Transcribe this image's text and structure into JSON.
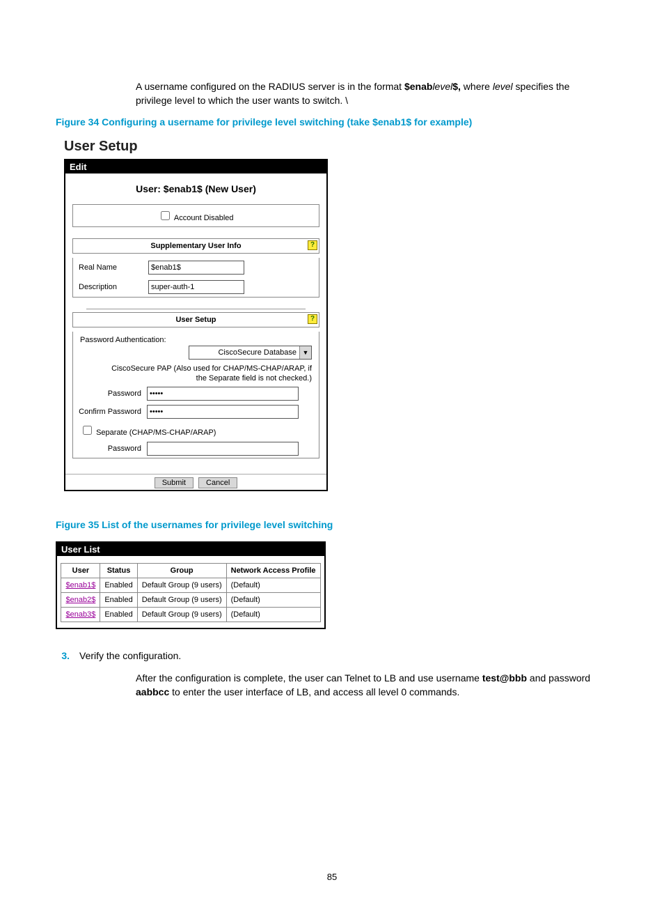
{
  "intro": {
    "line_pre": "A username configured on the RADIUS server is in the format ",
    "token1": "$enab",
    "token_it": "level",
    "token2": "$,",
    "line_mid1": " where ",
    "token_level": "level",
    "line_mid2": " specifies the privilege level to which the user wants to switch. \\"
  },
  "figure34_caption": "Figure 34 Configuring a username for privilege level switching (take $enab1$ for example)",
  "user_setup": {
    "panel_title": "User Setup",
    "edit_label": "Edit",
    "user_heading": "User: $enab1$ (New User)",
    "account_disabled_label": "Account Disabled",
    "supp_header": "Supplementary User Info",
    "real_name_label": "Real Name",
    "real_name_value": "$enab1$",
    "description_label": "Description",
    "description_value": "super-auth-1",
    "setup_header": "User Setup",
    "pw_auth_label": "Password Authentication:",
    "pw_auth_select": "CiscoSecure Database",
    "pap_note": "CiscoSecure PAP (Also used for CHAP/MS-CHAP/ARAP, if the Separate field is not checked.)",
    "password_label": "Password",
    "confirm_label": "Confirm Password",
    "password_mask": "•••••",
    "separate_label": "Separate (CHAP/MS-CHAP/ARAP)",
    "submit_label": "Submit",
    "cancel_label": "Cancel",
    "help_symbol": "?"
  },
  "figure35_caption": "Figure 35 List of the usernames for privilege level switching",
  "user_list": {
    "header": "User List",
    "columns": [
      "User",
      "Status",
      "Group",
      "Network Access Profile"
    ],
    "rows": [
      {
        "user": "$enab1$",
        "status": "Enabled",
        "group": "Default Group (9 users)",
        "nap": "(Default)"
      },
      {
        "user": "$enab2$",
        "status": "Enabled",
        "group": "Default Group (9 users)",
        "nap": "(Default)"
      },
      {
        "user": "$enab3$",
        "status": "Enabled",
        "group": "Default Group (9 users)",
        "nap": "(Default)"
      }
    ]
  },
  "step3": {
    "num": "3.",
    "text": "Verify the configuration.",
    "para_pre": "After the configuration is complete, the user can Telnet to LB and use username ",
    "bold1": "test@bbb",
    "para_mid": " and password ",
    "bold2": "aabbcc",
    "para_post": " to enter the user interface of LB, and access all level 0 commands."
  },
  "page_number": "85"
}
